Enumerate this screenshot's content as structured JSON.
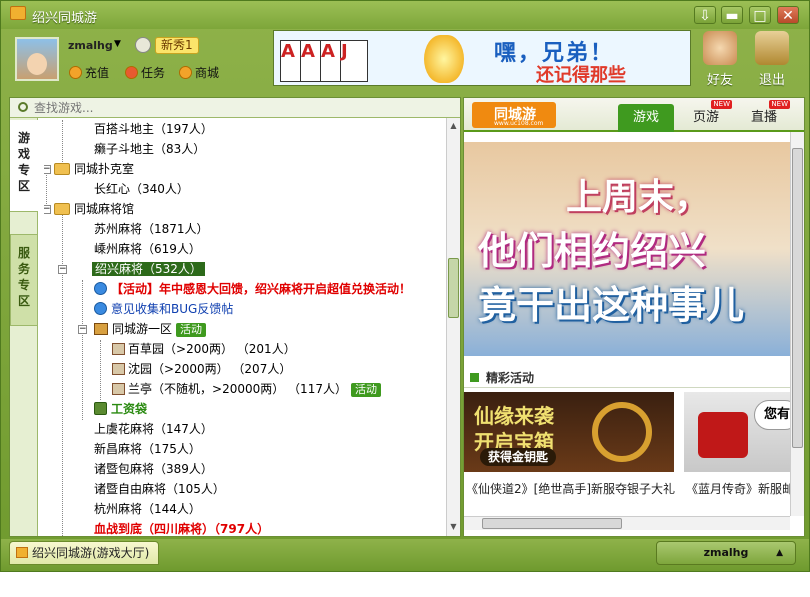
{
  "window": {
    "title": "绍兴同城游",
    "controls": [
      "⇩",
      "▬",
      "□",
      "✕"
    ]
  },
  "user": {
    "name": "zmalhg",
    "badge": "新秀1"
  },
  "header_menu": {
    "recharge": "充值",
    "tasks": "任务",
    "mall": "商城"
  },
  "banner": {
    "headline": "嘿，兄弟！",
    "sub": "还记得那些",
    "cards": [
      "A",
      "A",
      "A",
      "J"
    ]
  },
  "header_buttons": {
    "friends": "好友",
    "exit": "退出"
  },
  "search": {
    "placeholder": "查找游戏..."
  },
  "side_tabs": {
    "games": "游戏专区",
    "services": "服务专区"
  },
  "tree": [
    {
      "text": "百搭斗地主",
      "count": "（197人）"
    },
    {
      "text": "癞子斗地主",
      "count": "（83人）"
    },
    {
      "text": "同城扑克室",
      "count": ""
    },
    {
      "text": "长红心",
      "count": "（340人）"
    },
    {
      "text": "同城麻将馆",
      "count": ""
    },
    {
      "text": "苏州麻将",
      "count": "（1871人）"
    },
    {
      "text": "嵊州麻将",
      "count": "（619人）"
    },
    {
      "text": "绍兴麻将",
      "count": "（532人）"
    },
    {
      "text": "【活动】年中感恩大回馈，绍兴麻将开启超值兑换活动！",
      "count": ""
    },
    {
      "text": "意见收集和BUG反馈帖",
      "count": ""
    },
    {
      "text": "同城游一区",
      "count": "",
      "tag": "活动"
    },
    {
      "text": "百草园",
      "count": "（>200两）  （201人）"
    },
    {
      "text": "沈园",
      "count": "（>2000两）  （207人）"
    },
    {
      "text": "兰亭",
      "count": "（不随机，>20000两）  （117人）",
      "tag": "活动"
    },
    {
      "text": "工资袋",
      "count": ""
    },
    {
      "text": "上虞花麻将",
      "count": "（147人）"
    },
    {
      "text": "新昌麻将",
      "count": "（175人）"
    },
    {
      "text": "诸暨包麻将",
      "count": "（389人）"
    },
    {
      "text": "诸暨自由麻将",
      "count": "（105人）"
    },
    {
      "text": "杭州麻将",
      "count": "（144人）"
    },
    {
      "text": "血战到底（四川麻将）",
      "count": "（797人）"
    }
  ],
  "right": {
    "logo": "同城游",
    "logo_sub": "www.uc108.com",
    "tabs": [
      {
        "label": "游戏",
        "new": ""
      },
      {
        "label": "页游",
        "new": "NEW"
      },
      {
        "label": "直播",
        "new": "NEW"
      }
    ],
    "promo": {
      "line1": "上周末，",
      "line2": "他们相约绍兴",
      "line3": "竟干出这种事儿"
    },
    "activities_title": "精彩活动",
    "act1": {
      "t1": "仙缘来袭",
      "t2": "开启宝箱",
      "t3": "获得金钥匙",
      "caption": "《仙侠道2》[绝世高手]新服夺银子大礼"
    },
    "act2": {
      "bubble": "您有",
      "caption": "《蓝月传奇》新服邮"
    }
  },
  "bottom": {
    "tab": "绍兴同城游(游戏大厅)",
    "user": "zmalhg",
    "up": "▲"
  },
  "colors": {
    "frame": "#7da63a",
    "selected": "#2d6a1a",
    "tag": "#3f9a1f",
    "alert": "#e00000"
  }
}
